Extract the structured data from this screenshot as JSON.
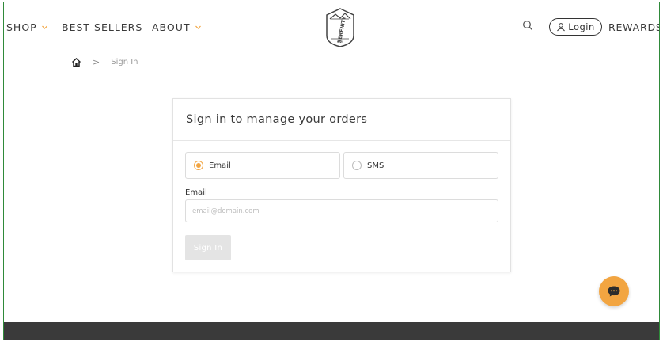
{
  "header": {
    "nav": [
      {
        "label": "SHOP",
        "has_dropdown": true
      },
      {
        "label": "BEST SELLERS",
        "has_dropdown": false
      },
      {
        "label": "ABOUT",
        "has_dropdown": true
      }
    ],
    "logo_text": "SERENITY",
    "logo_subtext": "KIDS",
    "login_label": "Login",
    "rewards_label": "REWARDS",
    "icons": {
      "search": "search-icon",
      "user": "user-icon",
      "chevron": "chevron-down-icon"
    }
  },
  "breadcrumb": {
    "home_icon": "home-icon",
    "separator": ">",
    "current": "Sign In"
  },
  "signin_card": {
    "title": "Sign in to manage your orders",
    "options": [
      {
        "label": "Email",
        "selected": true
      },
      {
        "label": "SMS",
        "selected": false
      }
    ],
    "field_label": "Email",
    "field_placeholder": "email@domain.com",
    "field_value": "",
    "submit_label": "Sign In"
  },
  "chat": {
    "icon": "chat-bubble-icon"
  },
  "colors": {
    "accent": "#f2a541",
    "text": "#3a3a3a",
    "footer": "#3a3a3a",
    "button_disabled": "#e4e4e4"
  }
}
